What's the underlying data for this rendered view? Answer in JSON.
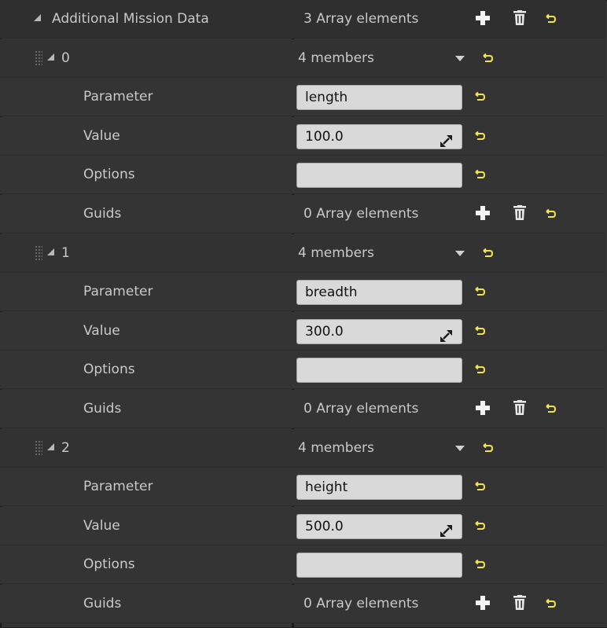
{
  "header": {
    "label": "Additional Mission Data",
    "value": "3 Array elements"
  },
  "elements": [
    {
      "index": "0",
      "members": "4 members",
      "parameter_label": "Parameter",
      "parameter_value": "length",
      "value_label": "Value",
      "value_value": "100.0",
      "options_label": "Options",
      "options_value": "",
      "guids_label": "Guids",
      "guids_value": "0 Array elements"
    },
    {
      "index": "1",
      "members": "4 members",
      "parameter_label": "Parameter",
      "parameter_value": "breadth",
      "value_label": "Value",
      "value_value": "300.0",
      "options_label": "Options",
      "options_value": "",
      "guids_label": "Guids",
      "guids_value": "0 Array elements"
    },
    {
      "index": "2",
      "members": "4 members",
      "parameter_label": "Parameter",
      "parameter_value": "height",
      "value_label": "Value",
      "value_value": "500.0",
      "options_label": "Options",
      "options_value": "",
      "guids_label": "Guids",
      "guids_value": "0 Array elements"
    }
  ],
  "colors": {
    "reset_arrow": "#f2e34c",
    "panel_bg": "#343434",
    "field_bg": "#d9d9d9"
  },
  "icons": [
    "expand-triangle-icon",
    "add-icon",
    "trash-icon",
    "reset-arrow-icon",
    "drag-grip-icon",
    "combo-arrow-icon",
    "spinner-arrow-icon"
  ]
}
